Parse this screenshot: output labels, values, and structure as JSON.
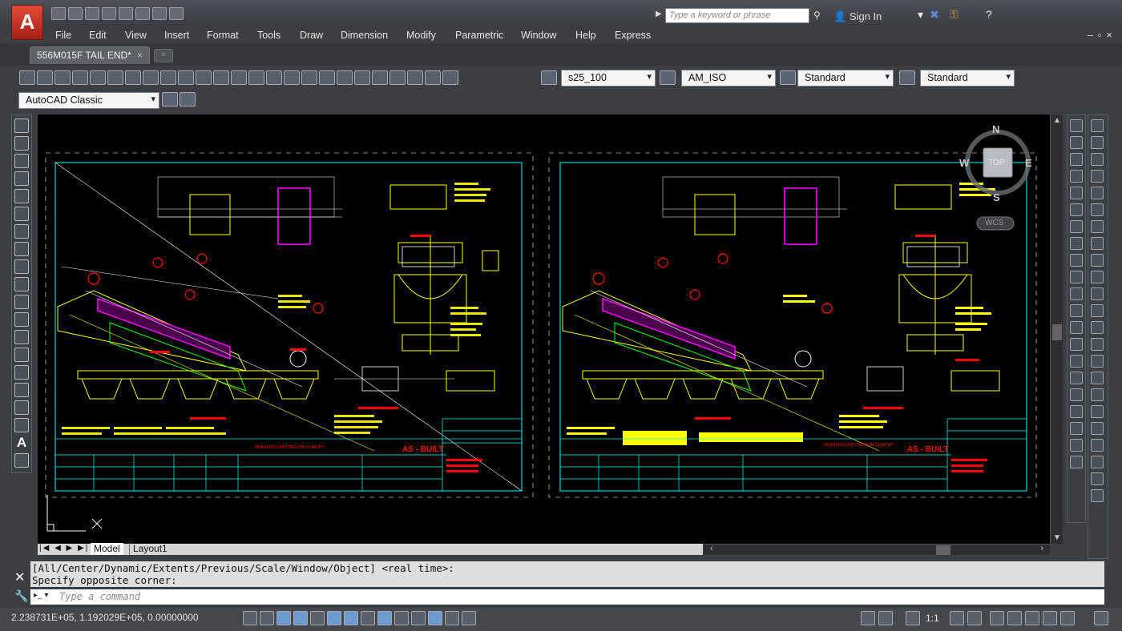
{
  "app": {
    "logo_letter": "A"
  },
  "titlebar": {
    "search_placeholder": "Type a keyword or phrase",
    "sign_in": "Sign In"
  },
  "menu": [
    "File",
    "Edit",
    "View",
    "Insert",
    "Format",
    "Tools",
    "Draw",
    "Dimension",
    "Modify",
    "Parametric",
    "Window",
    "Help",
    "Express"
  ],
  "document_tab": {
    "label": "556M015F TAIL END*",
    "close": "×"
  },
  "toolbar": {
    "text_style": "s25_100",
    "dim_style": "AM_ISO",
    "table_style": "Standard",
    "multileader_style": "Standard",
    "workspace": "AutoCAD Classic"
  },
  "viewcube": {
    "north": "N",
    "south": "S",
    "east": "E",
    "west": "W",
    "face": "TOP",
    "ucs": "WCS"
  },
  "layout_tabs": {
    "model": "Model",
    "layout1": "Layout1"
  },
  "command": {
    "history": [
      "[All/Center/Dynamic/Extents/Previous/Scale/Window/Object] <real time>:",
      "Specify opposite corner:"
    ],
    "placeholder": "Type a command"
  },
  "status": {
    "coordinates": "2.238731E+05, 1.192029E+05, 0.00000000",
    "annotation_scale": "1:1"
  },
  "drawing": {
    "title_left": "AS - BUILT",
    "title_right": "AS - BUILT",
    "note": "*BEARINGS OMITTED FOR CLARITY*"
  },
  "colors": {
    "background": "#000000",
    "frame": "#00ffff",
    "line": "#ffff00",
    "red": "#ff0000",
    "green": "#00ff00",
    "magenta": "#ff00ff"
  }
}
